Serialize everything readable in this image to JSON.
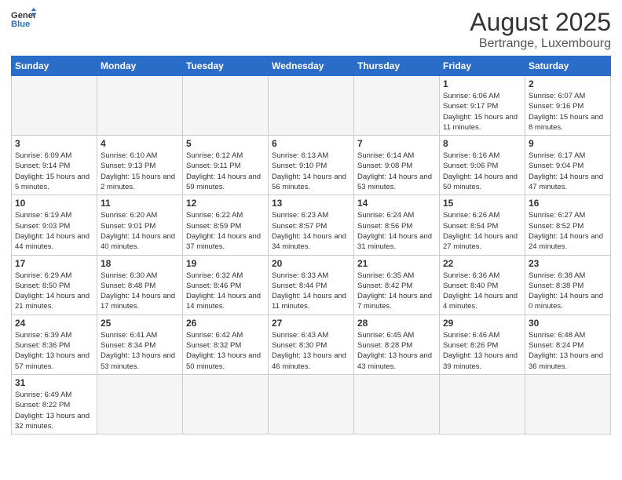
{
  "header": {
    "logo_general": "General",
    "logo_blue": "Blue",
    "title": "August 2025",
    "subtitle": "Bertrange, Luxembourg"
  },
  "days_of_week": [
    "Sunday",
    "Monday",
    "Tuesday",
    "Wednesday",
    "Thursday",
    "Friday",
    "Saturday"
  ],
  "weeks": [
    [
      {
        "day": "",
        "info": ""
      },
      {
        "day": "",
        "info": ""
      },
      {
        "day": "",
        "info": ""
      },
      {
        "day": "",
        "info": ""
      },
      {
        "day": "",
        "info": ""
      },
      {
        "day": "1",
        "info": "Sunrise: 6:06 AM\nSunset: 9:17 PM\nDaylight: 15 hours and 11 minutes."
      },
      {
        "day": "2",
        "info": "Sunrise: 6:07 AM\nSunset: 9:16 PM\nDaylight: 15 hours and 8 minutes."
      }
    ],
    [
      {
        "day": "3",
        "info": "Sunrise: 6:09 AM\nSunset: 9:14 PM\nDaylight: 15 hours and 5 minutes."
      },
      {
        "day": "4",
        "info": "Sunrise: 6:10 AM\nSunset: 9:13 PM\nDaylight: 15 hours and 2 minutes."
      },
      {
        "day": "5",
        "info": "Sunrise: 6:12 AM\nSunset: 9:11 PM\nDaylight: 14 hours and 59 minutes."
      },
      {
        "day": "6",
        "info": "Sunrise: 6:13 AM\nSunset: 9:10 PM\nDaylight: 14 hours and 56 minutes."
      },
      {
        "day": "7",
        "info": "Sunrise: 6:14 AM\nSunset: 9:08 PM\nDaylight: 14 hours and 53 minutes."
      },
      {
        "day": "8",
        "info": "Sunrise: 6:16 AM\nSunset: 9:06 PM\nDaylight: 14 hours and 50 minutes."
      },
      {
        "day": "9",
        "info": "Sunrise: 6:17 AM\nSunset: 9:04 PM\nDaylight: 14 hours and 47 minutes."
      }
    ],
    [
      {
        "day": "10",
        "info": "Sunrise: 6:19 AM\nSunset: 9:03 PM\nDaylight: 14 hours and 44 minutes."
      },
      {
        "day": "11",
        "info": "Sunrise: 6:20 AM\nSunset: 9:01 PM\nDaylight: 14 hours and 40 minutes."
      },
      {
        "day": "12",
        "info": "Sunrise: 6:22 AM\nSunset: 8:59 PM\nDaylight: 14 hours and 37 minutes."
      },
      {
        "day": "13",
        "info": "Sunrise: 6:23 AM\nSunset: 8:57 PM\nDaylight: 14 hours and 34 minutes."
      },
      {
        "day": "14",
        "info": "Sunrise: 6:24 AM\nSunset: 8:56 PM\nDaylight: 14 hours and 31 minutes."
      },
      {
        "day": "15",
        "info": "Sunrise: 6:26 AM\nSunset: 8:54 PM\nDaylight: 14 hours and 27 minutes."
      },
      {
        "day": "16",
        "info": "Sunrise: 6:27 AM\nSunset: 8:52 PM\nDaylight: 14 hours and 24 minutes."
      }
    ],
    [
      {
        "day": "17",
        "info": "Sunrise: 6:29 AM\nSunset: 8:50 PM\nDaylight: 14 hours and 21 minutes."
      },
      {
        "day": "18",
        "info": "Sunrise: 6:30 AM\nSunset: 8:48 PM\nDaylight: 14 hours and 17 minutes."
      },
      {
        "day": "19",
        "info": "Sunrise: 6:32 AM\nSunset: 8:46 PM\nDaylight: 14 hours and 14 minutes."
      },
      {
        "day": "20",
        "info": "Sunrise: 6:33 AM\nSunset: 8:44 PM\nDaylight: 14 hours and 11 minutes."
      },
      {
        "day": "21",
        "info": "Sunrise: 6:35 AM\nSunset: 8:42 PM\nDaylight: 14 hours and 7 minutes."
      },
      {
        "day": "22",
        "info": "Sunrise: 6:36 AM\nSunset: 8:40 PM\nDaylight: 14 hours and 4 minutes."
      },
      {
        "day": "23",
        "info": "Sunrise: 6:38 AM\nSunset: 8:38 PM\nDaylight: 14 hours and 0 minutes."
      }
    ],
    [
      {
        "day": "24",
        "info": "Sunrise: 6:39 AM\nSunset: 8:36 PM\nDaylight: 13 hours and 57 minutes."
      },
      {
        "day": "25",
        "info": "Sunrise: 6:41 AM\nSunset: 8:34 PM\nDaylight: 13 hours and 53 minutes."
      },
      {
        "day": "26",
        "info": "Sunrise: 6:42 AM\nSunset: 8:32 PM\nDaylight: 13 hours and 50 minutes."
      },
      {
        "day": "27",
        "info": "Sunrise: 6:43 AM\nSunset: 8:30 PM\nDaylight: 13 hours and 46 minutes."
      },
      {
        "day": "28",
        "info": "Sunrise: 6:45 AM\nSunset: 8:28 PM\nDaylight: 13 hours and 43 minutes."
      },
      {
        "day": "29",
        "info": "Sunrise: 6:46 AM\nSunset: 8:26 PM\nDaylight: 13 hours and 39 minutes."
      },
      {
        "day": "30",
        "info": "Sunrise: 6:48 AM\nSunset: 8:24 PM\nDaylight: 13 hours and 36 minutes."
      }
    ],
    [
      {
        "day": "31",
        "info": "Sunrise: 6:49 AM\nSunset: 8:22 PM\nDaylight: 13 hours and 32 minutes."
      },
      {
        "day": "",
        "info": ""
      },
      {
        "day": "",
        "info": ""
      },
      {
        "day": "",
        "info": ""
      },
      {
        "day": "",
        "info": ""
      },
      {
        "day": "",
        "info": ""
      },
      {
        "day": "",
        "info": ""
      }
    ]
  ]
}
